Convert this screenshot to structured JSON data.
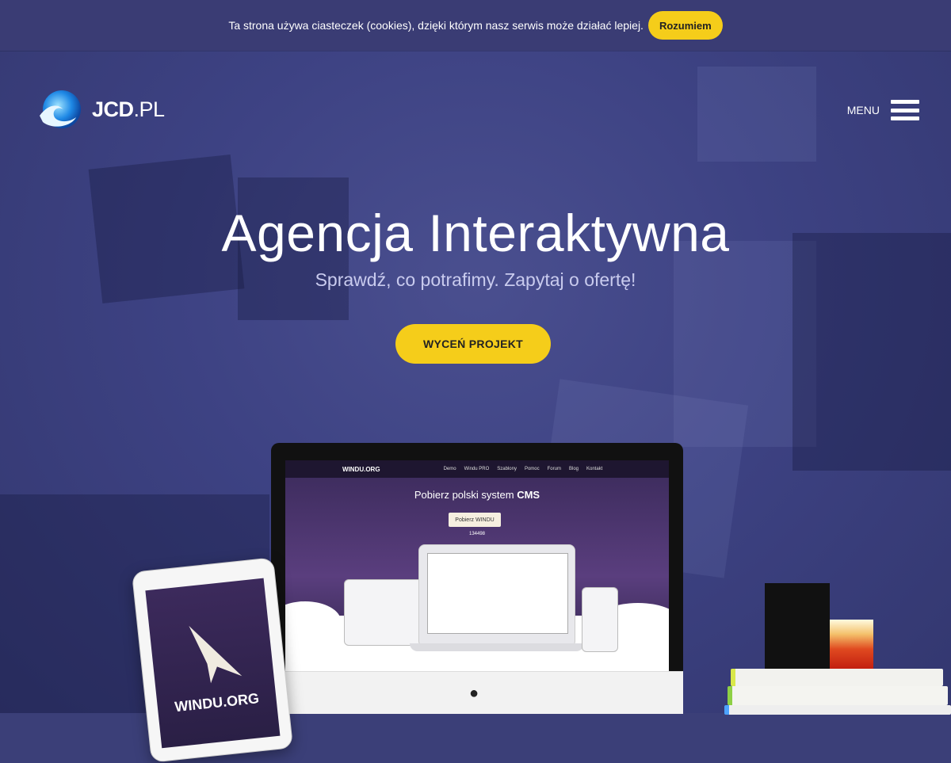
{
  "cookie_bar": {
    "message": "Ta strona używa ciasteczek (cookies), dzięki którym nasz serwis może działać lepiej.",
    "button_label": "Rozumiem"
  },
  "header": {
    "logo_bold": "JCD",
    "logo_light": ".PL",
    "menu_label": "MENU"
  },
  "hero": {
    "title": "Agencja Interaktywna",
    "subtitle": "Sprawdź, co potrafimy. Zapytaj o ofertę!",
    "cta_label": "WYCEŃ PROJEKT"
  },
  "devices": {
    "site_logo": "WINDU.ORG",
    "site_menu": [
      "Demo",
      "Windu PRO",
      "Szablony",
      "Pomoc",
      "Forum",
      "Blog",
      "Kontakt"
    ],
    "site_heading_prefix": "Pobierz polski system ",
    "site_heading_bold": "CMS",
    "site_button": "Pobierz WINDU",
    "site_count": "134498",
    "ipad_label": "WINDU.ORG"
  },
  "colors": {
    "accent_yellow": "#f5cd1a",
    "overlay_blue": "#3d4283"
  }
}
